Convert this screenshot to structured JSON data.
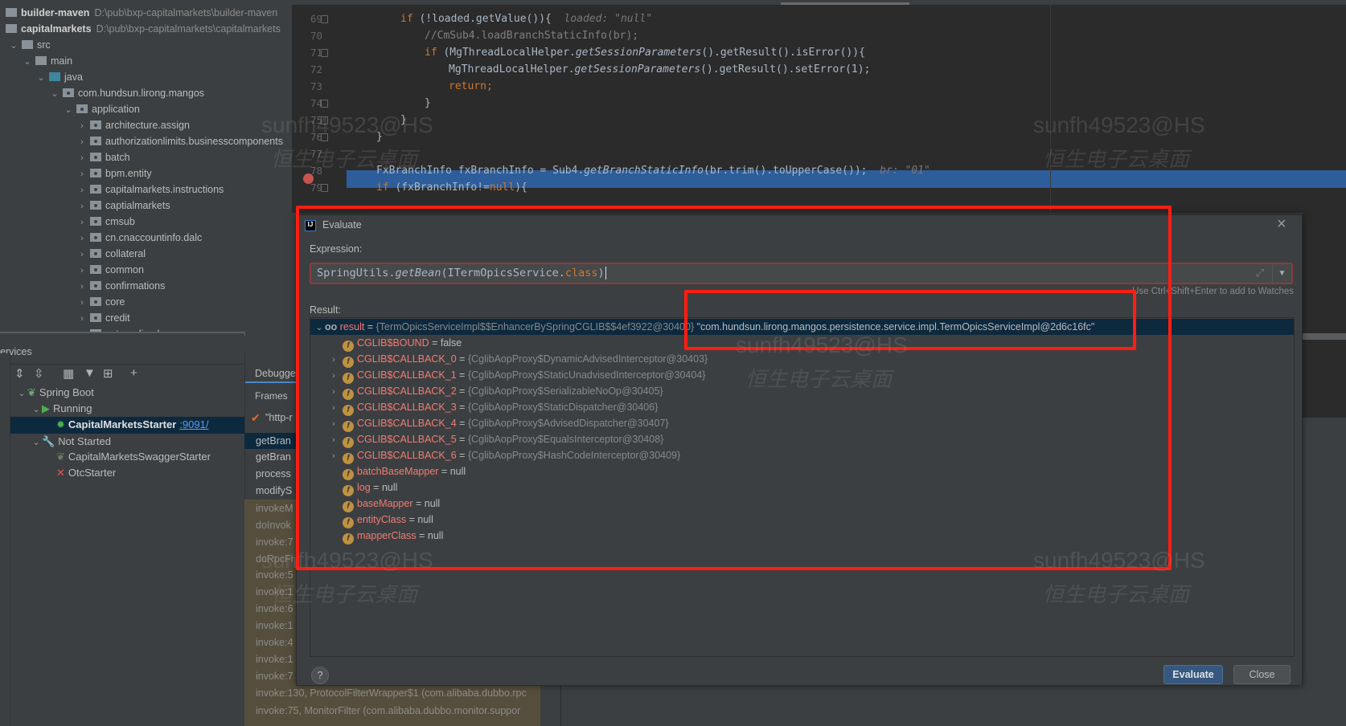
{
  "project_tree": [
    {
      "label": "builder-maven",
      "path": "D:\\pub\\bxp-capitalmarkets\\builder-maven",
      "bold": true
    },
    {
      "label": "capitalmarkets",
      "path": "D:\\pub\\bxp-capitalmarkets\\capitalmarkets",
      "bold": true
    },
    {
      "label": "src"
    },
    {
      "label": "main"
    },
    {
      "label": "java"
    },
    {
      "label": "com.hundsun.lirong.mangos"
    },
    {
      "label": "application"
    },
    {
      "label": "architecture.assign"
    },
    {
      "label": "authorizationlimits.businesscomponents"
    },
    {
      "label": "batch"
    },
    {
      "label": "bpm.entity"
    },
    {
      "label": "capitalmarkets.instructions"
    },
    {
      "label": "captialmarkets"
    },
    {
      "label": "cmsub"
    },
    {
      "label": "cn.cnaccountinfo.dalc"
    },
    {
      "label": "collateral"
    },
    {
      "label": "common"
    },
    {
      "label": "confirmations"
    },
    {
      "label": "core"
    },
    {
      "label": "credit"
    },
    {
      "label": "externalimpl"
    }
  ],
  "editor": {
    "lines": [
      {
        "n": "69",
        "indent": 1,
        "parts": [
          [
            "kw",
            "if "
          ],
          [
            "",
            "(!loaded.getValue()){  "
          ],
          [
            "hint",
            "loaded: \"null\""
          ]
        ]
      },
      {
        "n": "70",
        "indent": 2,
        "parts": [
          [
            "cm",
            "//CmSub4.loadBranchStaticInfo(br);"
          ]
        ]
      },
      {
        "n": "71",
        "indent": 2,
        "parts": [
          [
            "kw",
            "if "
          ],
          [
            "",
            "(MgThreadLocalHelper."
          ],
          [
            "it",
            "getSessionParameters"
          ],
          [
            "",
            "().getResult().isError()){"
          ]
        ]
      },
      {
        "n": "72",
        "indent": 3,
        "parts": [
          [
            "",
            "MgThreadLocalHelper."
          ],
          [
            "it",
            "getSessionParameters"
          ],
          [
            "",
            "().getResult().setError(1);"
          ]
        ]
      },
      {
        "n": "73",
        "indent": 3,
        "parts": [
          [
            "kw",
            "return;"
          ]
        ]
      },
      {
        "n": "74",
        "indent": 2,
        "parts": [
          [
            "",
            "}"
          ]
        ]
      },
      {
        "n": "75",
        "indent": 1,
        "parts": [
          [
            "",
            "}"
          ]
        ]
      },
      {
        "n": "76",
        "indent": 0,
        "parts": [
          [
            "",
            "}"
          ]
        ]
      },
      {
        "n": "77",
        "indent": 0,
        "parts": []
      },
      {
        "n": "78",
        "indent": 0,
        "parts": [
          [
            "",
            "FxBranchInfo fxBranchInfo = Sub4."
          ],
          [
            "it",
            "getBranchStaticInfo"
          ],
          [
            "",
            "(br.trim().toUpperCase());  "
          ],
          [
            "hint",
            "br: \"01\""
          ]
        ]
      },
      {
        "n": "79",
        "indent": 0,
        "parts": [
          [
            "kw",
            "if "
          ],
          [
            "",
            "(fxBranchInfo!="
          ],
          [
            "kw",
            "null"
          ],
          [
            "",
            "){"
          ]
        ]
      }
    ]
  },
  "services": {
    "title": "ervices",
    "tree": [
      {
        "label": "Spring Boot",
        "level": 0
      },
      {
        "label": "Running",
        "level": 1
      },
      {
        "label": "CapitalMarketsStarter",
        "port": ":9091/",
        "level": 2,
        "selected": true
      },
      {
        "label": "Not Started",
        "level": 1
      },
      {
        "label": "CapitalMarketsSwaggerStarter",
        "level": 2
      },
      {
        "label": "OtcStarter",
        "level": 2
      }
    ]
  },
  "debugger": {
    "tab": "Debugger",
    "frames_label": "Frames",
    "thread": "\"http-r",
    "frames": [
      "getBran",
      "getBran",
      "process",
      "modifyS",
      "invokeM",
      "doInvok",
      "invoke:7",
      "doRpcFi",
      "invoke:5",
      "invoke:1",
      "invoke:6",
      "invoke:1",
      "invoke:4",
      "invoke:1",
      "invoke:7",
      "invoke:130, ProtocolFilterWrapper$1 (com.alibaba.dubbo.rpc",
      "invoke:75, MonitorFilter (com.alibaba.dubbo.monitor.suppor"
    ]
  },
  "dialog": {
    "title": "Evaluate",
    "expression_label": "Expression:",
    "expression_pre": "SpringUtils.",
    "expression_method": "getBean",
    "expression_mid": "(ITermOpicsService.",
    "expression_kw": "class",
    "expression_post": ")",
    "hint": "Use Ctrl+Shift+Enter to add to Watches",
    "result_label": "Result:",
    "result": {
      "name": "result",
      "type": "{TermOpicsServiceImpl$$EnhancerBySpringCGLIB$$4ef3922@30400}",
      "value": "\"com.hundsun.lirong.mangos.persistence.service.impl.TermOpicsServiceImpl@2d6c16fc\""
    },
    "fields": [
      {
        "name": "CGLIB$BOUND",
        "value": "false",
        "expandable": false
      },
      {
        "name": "CGLIB$CALLBACK_0",
        "value": "{CglibAopProxy$DynamicAdvisedInterceptor@30403}",
        "expandable": true
      },
      {
        "name": "CGLIB$CALLBACK_1",
        "value": "{CglibAopProxy$StaticUnadvisedInterceptor@30404}",
        "expandable": true
      },
      {
        "name": "CGLIB$CALLBACK_2",
        "value": "{CglibAopProxy$SerializableNoOp@30405}",
        "expandable": true
      },
      {
        "name": "CGLIB$CALLBACK_3",
        "value": "{CglibAopProxy$StaticDispatcher@30406}",
        "expandable": true
      },
      {
        "name": "CGLIB$CALLBACK_4",
        "value": "{CglibAopProxy$AdvisedDispatcher@30407}",
        "expandable": true
      },
      {
        "name": "CGLIB$CALLBACK_5",
        "value": "{CglibAopProxy$EqualsInterceptor@30408}",
        "expandable": true
      },
      {
        "name": "CGLIB$CALLBACK_6",
        "value": "{CglibAopProxy$HashCodeInterceptor@30409}",
        "expandable": true
      },
      {
        "name": "batchBaseMapper",
        "value": "null",
        "expandable": false
      },
      {
        "name": "log",
        "value": "null",
        "expandable": false
      },
      {
        "name": "baseMapper",
        "value": "null",
        "expandable": false
      },
      {
        "name": "entityClass",
        "value": "null",
        "expandable": false
      },
      {
        "name": "mapperClass",
        "value": "null",
        "expandable": false
      }
    ],
    "help": "?",
    "evaluate": "Evaluate",
    "close": "Close"
  },
  "watermark": {
    "id": "sunfh49523@HS",
    "brand": "恒生电子云桌面"
  },
  "colors": {
    "annotation": "#ff1d12",
    "selection": "#2d5d9a",
    "field_name": "#f07c74",
    "keyword": "#cc7832"
  }
}
